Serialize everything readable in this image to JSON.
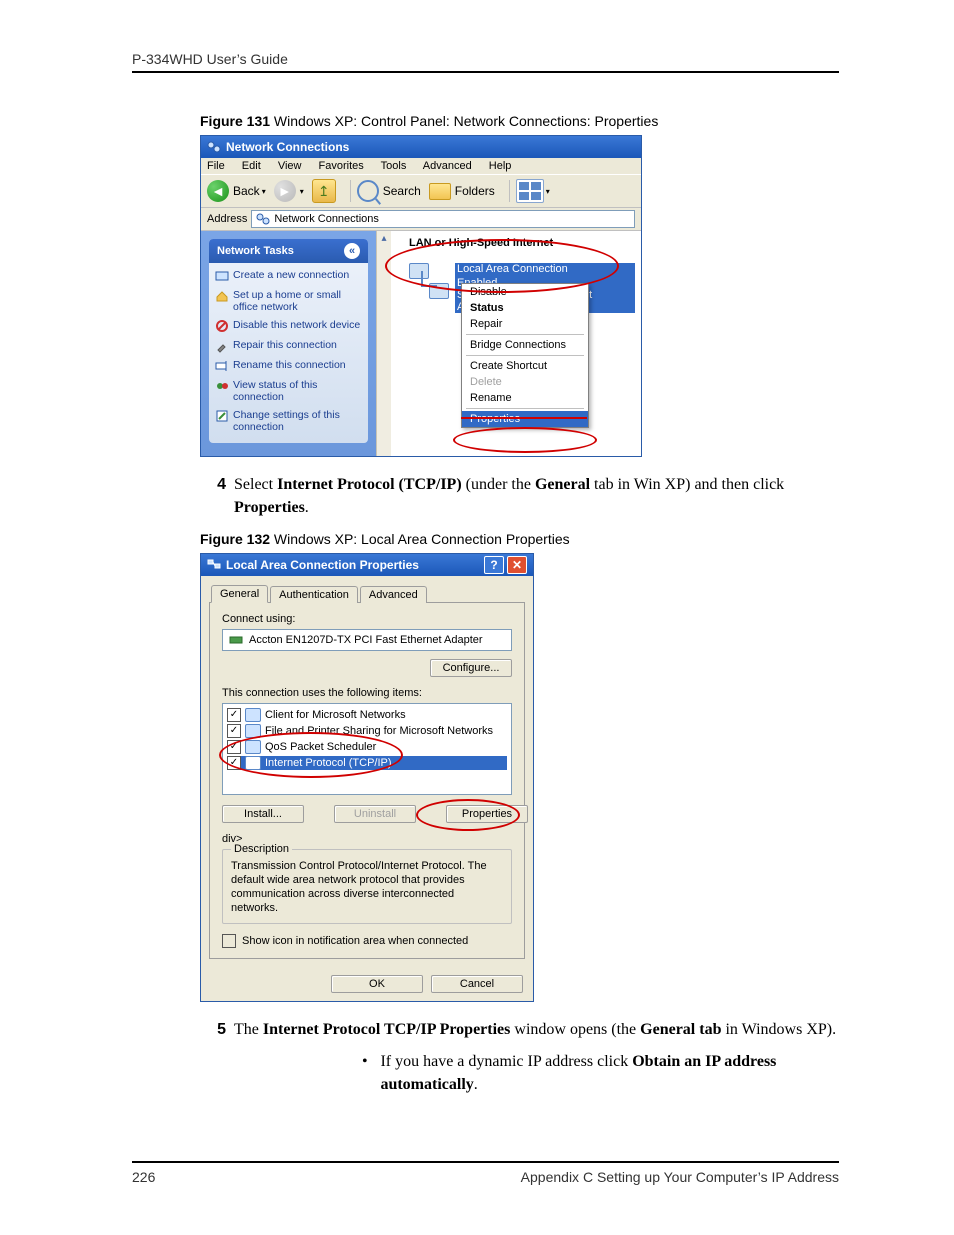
{
  "page": {
    "running_header": "P-334WHD User’s Guide",
    "footer_page": "226",
    "footer_text": "Appendix C Setting up Your Computer’s IP Address"
  },
  "fig131": {
    "caption_label": "Figure 131",
    "caption_text": "   Windows XP: Control Panel: Network Connections: Properties",
    "title": "Network Connections",
    "menu": [
      "File",
      "Edit",
      "View",
      "Favorites",
      "Tools",
      "Advanced",
      "Help"
    ],
    "toolbar": {
      "back": "Back",
      "search": "Search",
      "folders": "Folders"
    },
    "address_label": "Address",
    "address_value": "Network Connections",
    "tasks_header": "Network Tasks",
    "tasks": [
      "Create a new connection",
      "Set up a home or small office network",
      "Disable this network device",
      "Repair this connection",
      "Rename this connection",
      "View status of this connection",
      "Change settings of this connection"
    ],
    "section_header": "LAN or High-Speed Internet",
    "connection": {
      "name": "Local Area Connection",
      "status": "Enabled",
      "device": "Standard PCI Fast Ethernet Adapter"
    },
    "context_menu": {
      "disable": "Disable",
      "status": "Status",
      "repair": "Repair",
      "bridge": "Bridge Connections",
      "shortcut": "Create Shortcut",
      "delete": "Delete",
      "rename": "Rename",
      "properties": "Properties"
    }
  },
  "step4": {
    "num": "4",
    "pre": "Select ",
    "b1": "Internet Protocol (TCP/IP)",
    "mid": " (under the ",
    "b2": "General",
    "post1": " tab in Win XP) and then click ",
    "b3": "Properties",
    "tail": "."
  },
  "fig132": {
    "caption_label": "Figure 132",
    "caption_text": "   Windows XP: Local Area Connection Properties",
    "title": "Local Area Connection Properties",
    "tabs": [
      "General",
      "Authentication",
      "Advanced"
    ],
    "connect_using_label": "Connect using:",
    "adapter": "Accton EN1207D-TX PCI Fast Ethernet Adapter",
    "configure_btn": "Configure...",
    "items_label": "This connection uses the following items:",
    "items": [
      "Client for Microsoft Networks",
      "File and Printer Sharing for Microsoft Networks",
      "QoS Packet Scheduler",
      "Internet Protocol (TCP/IP)"
    ],
    "install_btn": "Install...",
    "uninstall_btn": "Uninstall",
    "properties_btn": "Properties",
    "desc_label": "Description",
    "desc_text": "Transmission Control Protocol/Internet Protocol. The default wide area network protocol that provides communication across diverse interconnected networks.",
    "show_icon": "Show icon in notification area when connected",
    "ok": "OK",
    "cancel": "Cancel"
  },
  "step5": {
    "num": "5",
    "pre": "The ",
    "b1": "Internet Protocol TCP/IP Properties",
    "mid": " window opens (the ",
    "b2": "General tab",
    "post": " in Windows XP)."
  },
  "bullet": {
    "pre": "If you have a dynamic IP address click ",
    "b1": "Obtain an IP address automatically",
    "tail": "."
  }
}
